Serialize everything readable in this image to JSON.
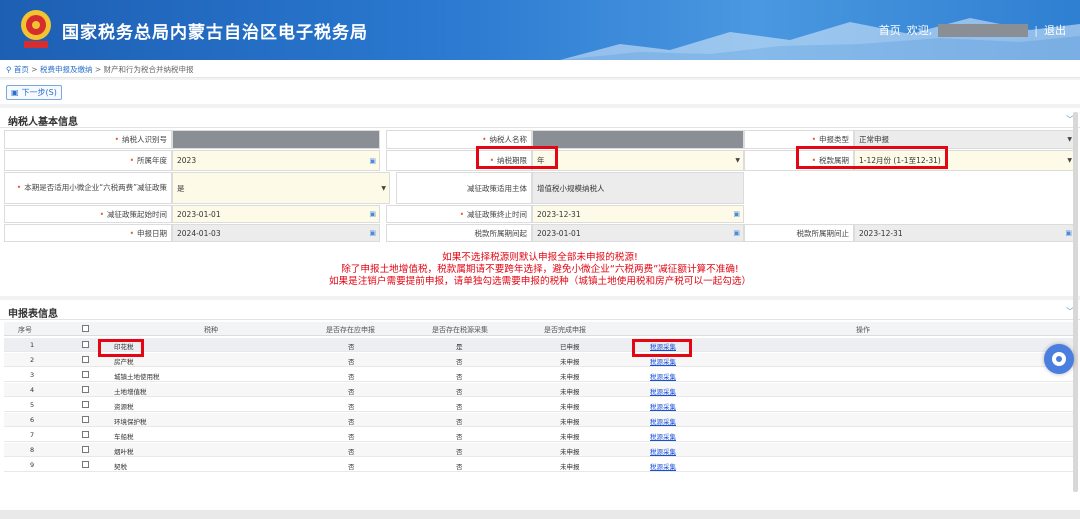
{
  "header": {
    "site_title": "国家税务总局内蒙古自治区电子税务局",
    "home_link": "首页",
    "welcome": "欢迎,",
    "logout": "退出"
  },
  "breadcrumb": {
    "home": "首页",
    "sep": ">",
    "level1": "税费申报及缴纳",
    "level2": "财产和行为税合并纳税申报"
  },
  "toolbar": {
    "next_label": "下一步(S)"
  },
  "taxpayer_panel": {
    "title": "纳税人基本信息",
    "fields": {
      "taxpayer_id_label": "纳税人识别号",
      "taxpayer_name_label": "纳税人名称",
      "declare_type_label": "申报类型",
      "declare_type_value": "正常申报",
      "year_label": "所属年度",
      "year_value": "2023",
      "period_label": "纳税期限",
      "period_value": "年",
      "tax_period_label": "税款属期",
      "tax_period_value": "1-12月份 (1-1至12-31)",
      "small_biz_label": "本期是否适用小微企业“六税两费”减征政策",
      "small_biz_value": "是",
      "policy_subject_label": "减征政策适用主体",
      "policy_subject_value": "增值税小规模纳税人",
      "policy_start_label": "减征政策起始时间",
      "policy_start_value": "2023-01-01",
      "policy_end_label": "减征政策终止时间",
      "policy_end_value": "2023-12-31",
      "declare_date_label": "申报日期",
      "declare_date_value": "2024-01-03",
      "period_start_label": "税款所属期间起",
      "period_start_value": "2023-01-01",
      "period_end_label": "税款所属期间止",
      "period_end_value": "2023-12-31"
    },
    "notices": [
      "如果不选择税源则默认申报全部未申报的税源!",
      "除了申报土地增值税，税款属期请不要跨年选择，避免小微企业“六税两费”减征额计算不准确!",
      "如果是注销户需要提前申报，请单独勾选需要申报的税种（城镇土地使用税和房产税可以一起勾选）"
    ]
  },
  "report_panel": {
    "title": "申报表信息",
    "headers": [
      "序号",
      "税种",
      "是否存在应申报",
      "是否存在税源采集",
      "是否完成申报",
      "操作"
    ],
    "rows": [
      {
        "no": "1",
        "tax": "印花税",
        "should": "否",
        "source": "是",
        "done": "已申报",
        "op": "税源采集"
      },
      {
        "no": "2",
        "tax": "房产税",
        "should": "否",
        "source": "否",
        "done": "未申报",
        "op": "税源采集"
      },
      {
        "no": "3",
        "tax": "城镇土地使用税",
        "should": "否",
        "source": "否",
        "done": "未申报",
        "op": "税源采集"
      },
      {
        "no": "4",
        "tax": "土地增值税",
        "should": "否",
        "source": "否",
        "done": "未申报",
        "op": "税源采集"
      },
      {
        "no": "5",
        "tax": "资源税",
        "should": "否",
        "source": "否",
        "done": "未申报",
        "op": "税源采集"
      },
      {
        "no": "6",
        "tax": "环境保护税",
        "should": "否",
        "source": "否",
        "done": "未申报",
        "op": "税源采集"
      },
      {
        "no": "7",
        "tax": "车船税",
        "should": "否",
        "source": "否",
        "done": "未申报",
        "op": "税源采集"
      },
      {
        "no": "8",
        "tax": "烟叶税",
        "should": "否",
        "source": "否",
        "done": "未申报",
        "op": "税源采集"
      },
      {
        "no": "9",
        "tax": "契税",
        "should": "否",
        "source": "否",
        "done": "未申报",
        "op": "税源采集"
      }
    ]
  },
  "colors": {
    "header_blue": "#2a78d0",
    "highlight_red": "#e30613",
    "link_blue": "#1a4fd8"
  }
}
